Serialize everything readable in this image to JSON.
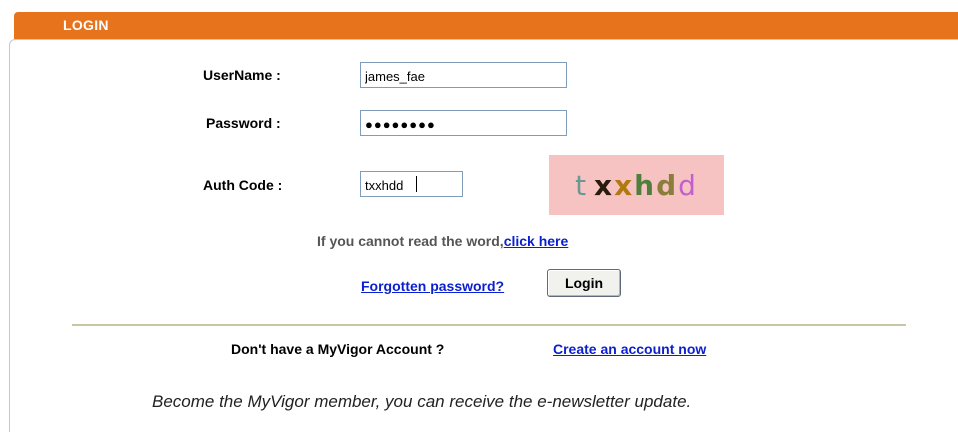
{
  "header": {
    "title": "LOGIN",
    "color": "#e7731d"
  },
  "form": {
    "username": {
      "label": "UserName :",
      "value": "james_fae"
    },
    "password": {
      "label": "Password :",
      "masked_value": "●●●●●●●●"
    },
    "auth_code": {
      "label": "Auth Code :",
      "value": "txxhdd"
    }
  },
  "captcha": {
    "chars": [
      {
        "ch": "t",
        "color": "#6a9a8f"
      },
      {
        "ch": "x",
        "color": "#2a1a10"
      },
      {
        "ch": "x",
        "color": "#b07a10"
      },
      {
        "ch": "h",
        "color": "#4f7f3a"
      },
      {
        "ch": "d",
        "color": "#8a7f3a"
      },
      {
        "ch": "d",
        "color": "#c05fcf"
      }
    ],
    "background": "#f7c2c2"
  },
  "hint": {
    "text": "If you cannot read the word,",
    "link": "click here"
  },
  "actions": {
    "forgot_link": "Forgotten password?",
    "login_button": "Login"
  },
  "signup": {
    "prompt": "Don't have a MyVigor Account ?",
    "link": "Create an account now",
    "newsletter": "Become the MyVigor member, you can receive the e-newsletter update."
  }
}
